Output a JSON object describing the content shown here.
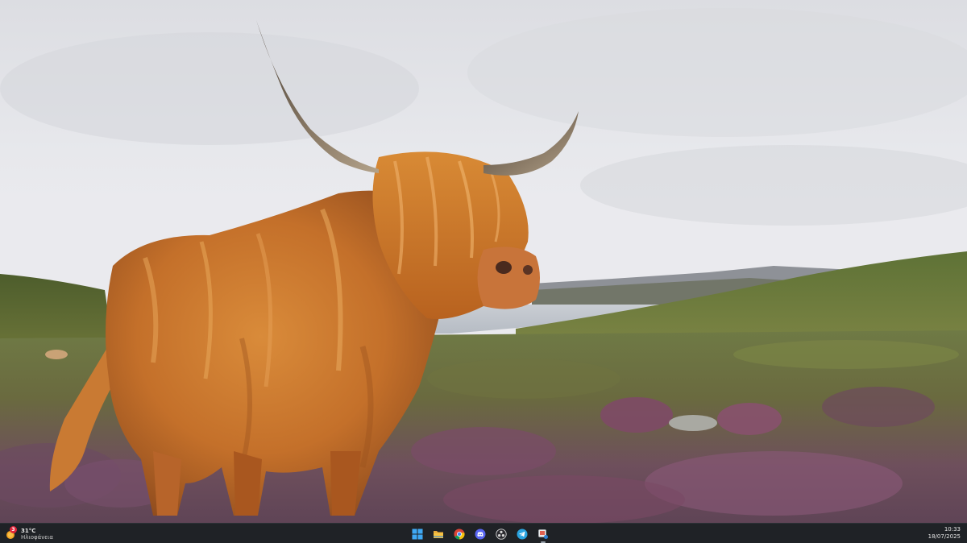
{
  "wallpaper": {
    "subject": "highland-cow-on-heather-moor"
  },
  "taskbar": {
    "weather": {
      "temperature": "31°C",
      "description": "Ηλιοφάνεια",
      "alert_count": "3",
      "icon": "sun-icon"
    },
    "apps": [
      {
        "name": "start-button",
        "icon": "windows-logo-icon"
      },
      {
        "name": "file-explorer",
        "icon": "folder-icon"
      },
      {
        "name": "chrome",
        "icon": "chrome-icon"
      },
      {
        "name": "discord",
        "icon": "discord-icon"
      },
      {
        "name": "obs-studio",
        "icon": "obs-icon"
      },
      {
        "name": "telegram",
        "icon": "telegram-icon"
      },
      {
        "name": "snipping-tool",
        "icon": "snipping-tool-icon",
        "active": true
      }
    ],
    "clock": {
      "time": "10:33",
      "date": "18/07/2025"
    },
    "colors": {
      "taskbar_bg": "#1f2226",
      "windows_blue": "#3fa9f5",
      "folder_yellow": "#f6c343",
      "discord": "#5865f2",
      "telegram": "#2aa3df",
      "alert_red": "#e0263c"
    }
  }
}
